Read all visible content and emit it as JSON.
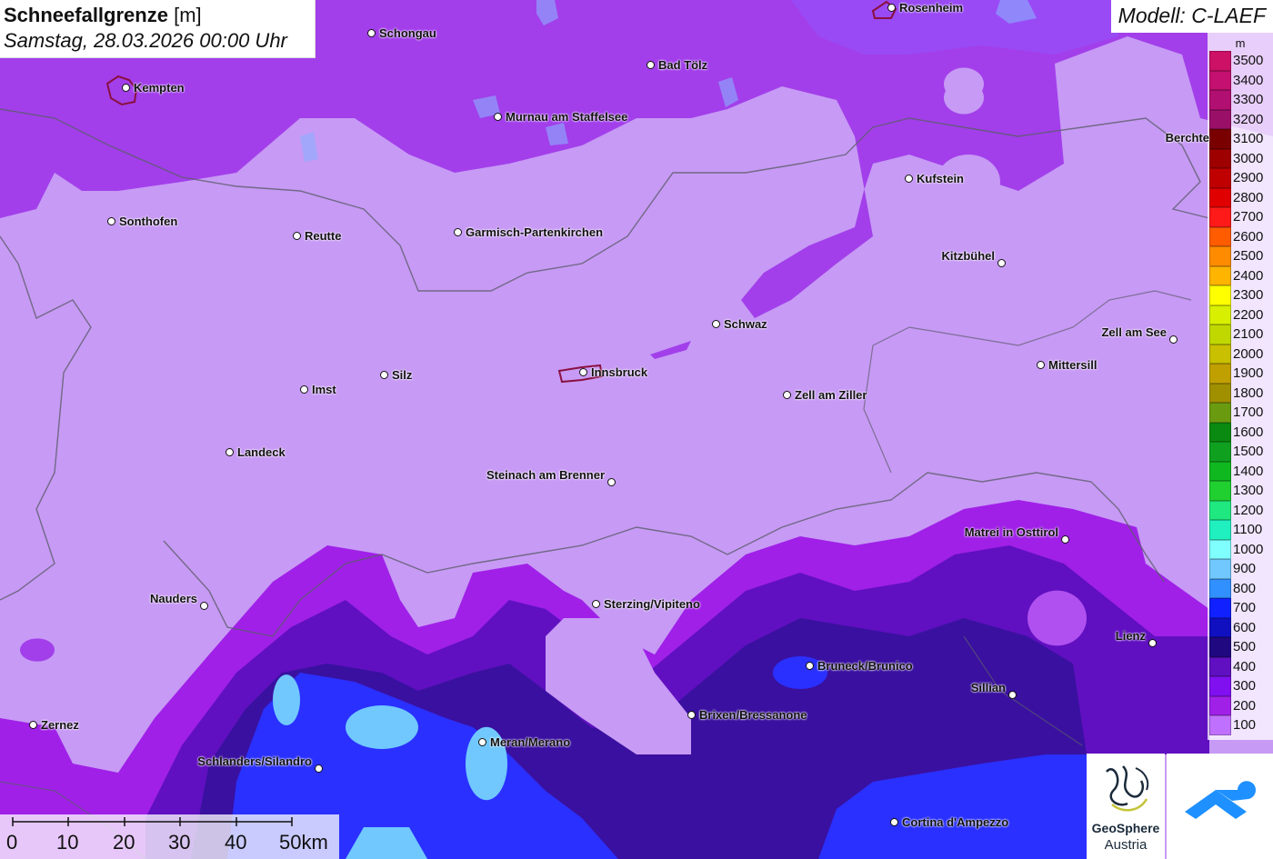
{
  "title": {
    "main": "Schneefallgrenze",
    "unit": "[m]",
    "date": "Samstag, 28.03.2026 00:00 Uhr"
  },
  "model": "Modell: C-LAEF",
  "legend": {
    "unit": "m",
    "items": [
      {
        "label": "3500",
        "color": "#cc1166"
      },
      {
        "label": "3400",
        "color": "#c41070"
      },
      {
        "label": "3300",
        "color": "#b20f72"
      },
      {
        "label": "3200",
        "color": "#9a1068"
      },
      {
        "label": "3100",
        "color": "#7a0000"
      },
      {
        "label": "3000",
        "color": "#9e0000"
      },
      {
        "label": "2900",
        "color": "#c00000"
      },
      {
        "label": "2800",
        "color": "#e00000"
      },
      {
        "label": "2700",
        "color": "#ff1a1a"
      },
      {
        "label": "2600",
        "color": "#ff5c00"
      },
      {
        "label": "2500",
        "color": "#ff8c00"
      },
      {
        "label": "2400",
        "color": "#ffb400"
      },
      {
        "label": "2300",
        "color": "#ffff00"
      },
      {
        "label": "2200",
        "color": "#d8f000"
      },
      {
        "label": "2100",
        "color": "#c0d800"
      },
      {
        "label": "2000",
        "color": "#c8c000"
      },
      {
        "label": "1900",
        "color": "#c0a000"
      },
      {
        "label": "1800",
        "color": "#a09000"
      },
      {
        "label": "1700",
        "color": "#6a9a10"
      },
      {
        "label": "1600",
        "color": "#0a8a10"
      },
      {
        "label": "1500",
        "color": "#10a020"
      },
      {
        "label": "1400",
        "color": "#10b820"
      },
      {
        "label": "1300",
        "color": "#20d030"
      },
      {
        "label": "1200",
        "color": "#20e880"
      },
      {
        "label": "1100",
        "color": "#20f0c0"
      },
      {
        "label": "1000",
        "color": "#80ffff"
      },
      {
        "label": "900",
        "color": "#70c8ff"
      },
      {
        "label": "800",
        "color": "#3090ff"
      },
      {
        "label": "700",
        "color": "#1020ff"
      },
      {
        "label": "600",
        "color": "#1010c0"
      },
      {
        "label": "500",
        "color": "#200880"
      },
      {
        "label": "400",
        "color": "#6010c0"
      },
      {
        "label": "300",
        "color": "#8010f0"
      },
      {
        "label": "200",
        "color": "#a020e8"
      },
      {
        "label": "100",
        "color": "#c070ff"
      }
    ]
  },
  "cities": [
    {
      "name": "Rosenheim"
    },
    {
      "name": "Schongau"
    },
    {
      "name": "Kempten"
    },
    {
      "name": "Bad Tölz"
    },
    {
      "name": "Murnau am Staffelsee"
    },
    {
      "name": "Berchte"
    },
    {
      "name": "Kufstein"
    },
    {
      "name": "Sonthofen"
    },
    {
      "name": "Reutte"
    },
    {
      "name": "Garmisch-Partenkirchen"
    },
    {
      "name": "Kitzbühel"
    },
    {
      "name": "Schwaz"
    },
    {
      "name": "Zell am See"
    },
    {
      "name": "Innsbruck"
    },
    {
      "name": "Silz"
    },
    {
      "name": "Mittersill"
    },
    {
      "name": "Imst"
    },
    {
      "name": "Zell am Ziller"
    },
    {
      "name": "Landeck"
    },
    {
      "name": "Steinach am Brenner"
    },
    {
      "name": "Matrei in Osttirol"
    },
    {
      "name": "Nauders"
    },
    {
      "name": "Sterzing/Vipiteno"
    },
    {
      "name": "Lienz"
    },
    {
      "name": "Bruneck/Brunico"
    },
    {
      "name": "Sillian"
    },
    {
      "name": "Brixen/Bressanone"
    },
    {
      "name": "Zernez"
    },
    {
      "name": "Meran/Merano"
    },
    {
      "name": "Schlanders/Silandro"
    },
    {
      "name": "Cortina d'Ampezzo"
    }
  ],
  "scale": {
    "labels": [
      "0",
      "10",
      "20",
      "30",
      "40",
      "50km"
    ]
  },
  "logos": {
    "geosphere_line1": "GeoSphere",
    "geosphere_line2": "Austria"
  }
}
